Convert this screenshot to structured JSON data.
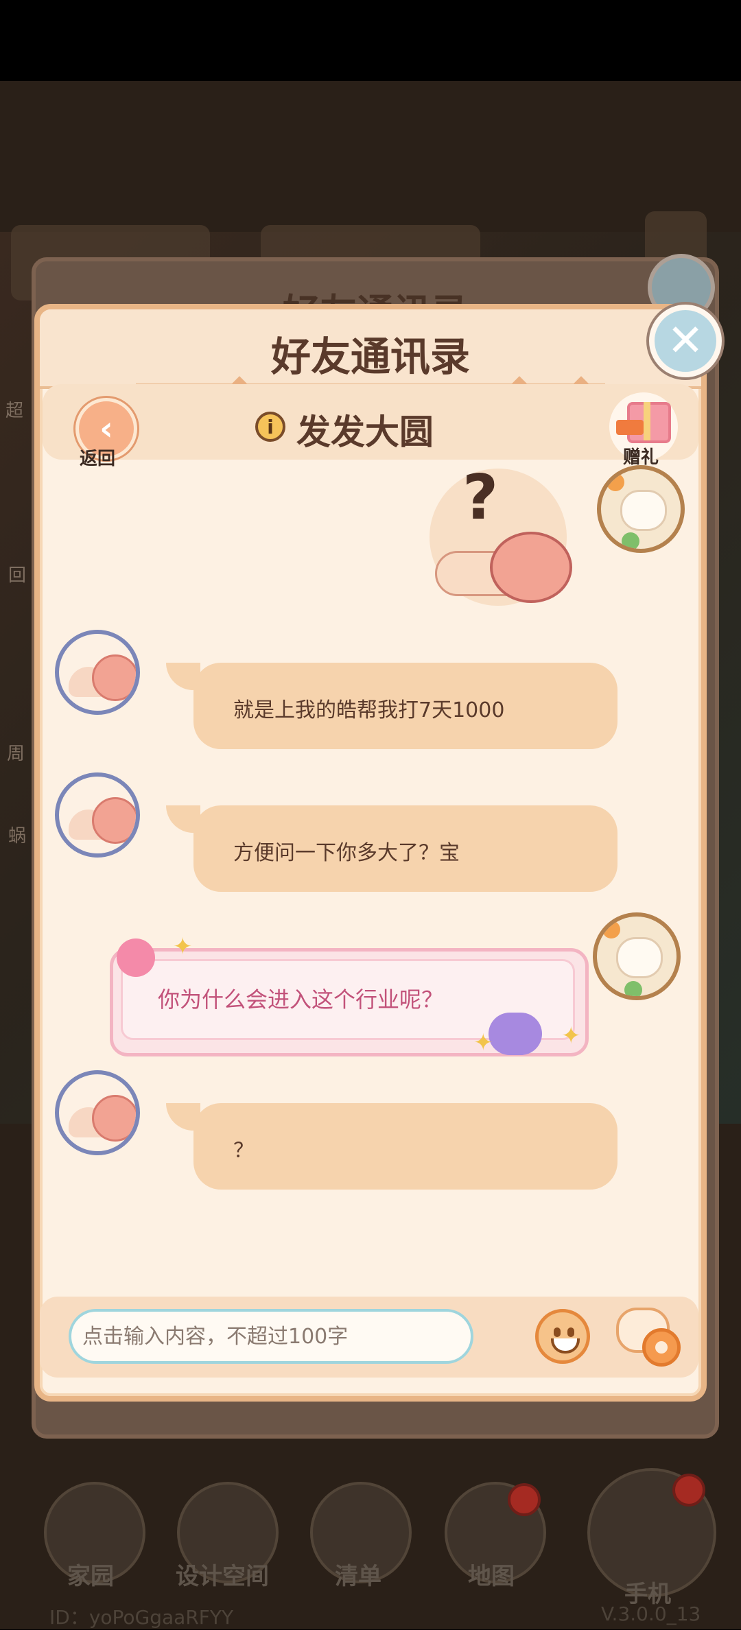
{
  "dialog": {
    "title": "好友通讯录",
    "back_title": "好友通讯录",
    "back_label": "返回",
    "friend_name": "发发大圆",
    "gift_label": "赠礼"
  },
  "messages": [
    {
      "sender": "friend",
      "text": "就是上我的皓帮我打7天1000"
    },
    {
      "sender": "friend",
      "text": "方便问一下你多大了？宝"
    },
    {
      "sender": "self",
      "text": "你为什么会进入这个行业呢？"
    },
    {
      "sender": "friend",
      "text": "？"
    }
  ],
  "input": {
    "placeholder": "点击输入内容，不超过100字"
  },
  "bottom_nav": [
    {
      "label": "家园"
    },
    {
      "label": "设计空间"
    },
    {
      "label": "清单"
    },
    {
      "label": "地图"
    },
    {
      "label": "手机"
    }
  ],
  "footer": {
    "uid": "ID：yoPoGgaaRFYY",
    "version": "V.3.0.0_13"
  },
  "side_labels": [
    "超",
    "回",
    "周",
    "蜗"
  ],
  "colors": {
    "card_bg": "#fdf1e3",
    "card_border": "#e8b586",
    "bubble": "#f6d3ad",
    "avatar_ring": "#7b86b8",
    "special_text": "#c2527a"
  },
  "icons": [
    "close-icon",
    "chevron-left-icon",
    "info-icon",
    "gift-icon",
    "emoji-icon",
    "chat-settings-icon",
    "home-icon",
    "design-icon",
    "list-icon",
    "map-pin-icon",
    "phone-icon"
  ]
}
